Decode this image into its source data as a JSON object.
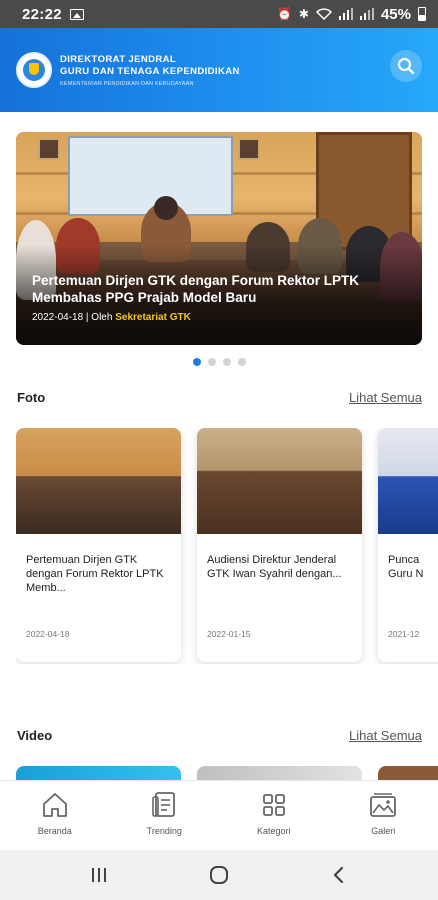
{
  "status_bar": {
    "time": "22:22",
    "battery": "45%"
  },
  "header": {
    "line1": "DIREKTORAT JENDRAL",
    "line2": "GURU DAN TENAGA KEPENDIDIKAN",
    "subtitle": "KEMENTERIAN PENDIDIKAN DAN KEBUDAYAAN",
    "logo_icon": "tut-wuri-handayani-logo",
    "search_icon": "search-icon",
    "colors": {
      "header_start": "#1672d8",
      "header_end": "#26a8f8"
    }
  },
  "banner": {
    "title": "Pertemuan Dirjen GTK dengan Forum Rektor LPTK Membahas PPG Prajab Model Baru",
    "date": "2022-04-18",
    "by": " | Oleh ",
    "author": "Sekretariat GTK",
    "colors": {
      "author": "#f7c71b"
    },
    "carousel_total": 4,
    "carousel_active": 1
  },
  "foto": {
    "title": "Foto",
    "see_all": "Lihat Semua",
    "cards": [
      {
        "title": "Pertemuan Dirjen GTK dengan Forum Rektor LPTK Memb...",
        "date": "2022-04-18"
      },
      {
        "title": "Audiensi Direktur Jenderal GTK Iwan Syahril dengan...",
        "date": "2022-01-15"
      },
      {
        "title": "Punca Guru N",
        "date": "2021-12"
      }
    ]
  },
  "video": {
    "title": "Video",
    "see_all": "Lihat Semua"
  },
  "bottom_nav": [
    {
      "label": "Beranda",
      "icon": "home-icon"
    },
    {
      "label": "Trending",
      "icon": "trending-icon"
    },
    {
      "label": "Kategori",
      "icon": "grid-icon"
    },
    {
      "label": "Galeri",
      "icon": "gallery-icon"
    }
  ],
  "system_nav": {
    "recent": "recent-apps-icon",
    "home": "home-circle-icon",
    "back": "back-icon"
  },
  "accent": "#1e7be0"
}
